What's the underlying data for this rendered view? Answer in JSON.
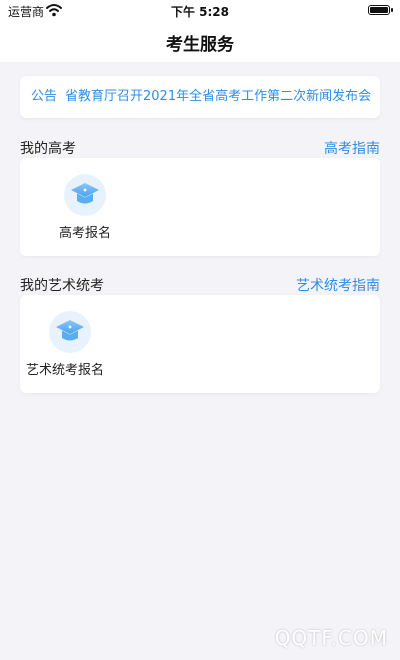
{
  "status_bar": {
    "carrier": "运营商",
    "time": "下午 5:28"
  },
  "nav": {
    "title": "考生服务"
  },
  "notice": {
    "tag": "公告",
    "text": "省教育厅召开2021年全省高考工作第二次新闻发布会"
  },
  "gaokao": {
    "label": "我的高考",
    "link": "高考指南",
    "items": [
      {
        "label": "高考报名",
        "icon": "graduation-cap-icon"
      }
    ]
  },
  "art": {
    "label": "我的艺术统考",
    "link": "艺术统考指南",
    "items": [
      {
        "label": "艺术统考报名",
        "icon": "graduation-cap-icon"
      }
    ]
  },
  "watermark": "QQTF.COM",
  "colors": {
    "accent": "#2f8ee6",
    "background": "#f4f4f8",
    "icon_bg": "#e8f2fd"
  }
}
